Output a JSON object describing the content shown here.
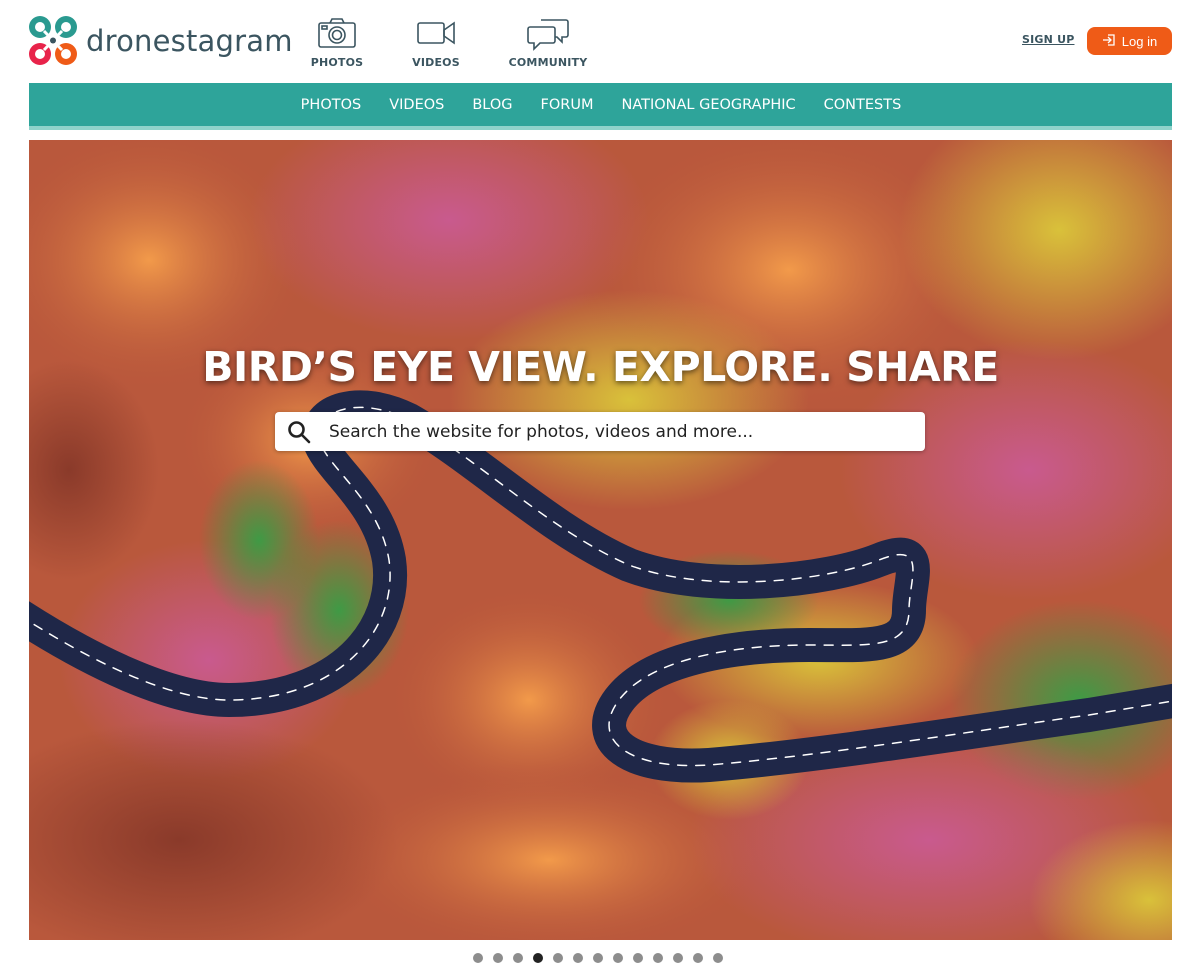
{
  "brand": {
    "name": "dronestagram"
  },
  "topnav": [
    {
      "label": "PHOTOS",
      "icon": "camera-icon"
    },
    {
      "label": "VIDEOS",
      "icon": "video-camera-icon"
    },
    {
      "label": "COMMUNITY",
      "icon": "chat-bubbles-icon"
    }
  ],
  "account": {
    "signup_label": "SIGN UP",
    "login_label": "Log in",
    "login_color": "#ef5b17"
  },
  "mainnav": {
    "color": "#2ea49a",
    "items": [
      "PHOTOS",
      "VIDEOS",
      "BLOG",
      "FORUM",
      "NATIONAL GEOGRAPHIC",
      "CONTESTS"
    ]
  },
  "hero": {
    "headline": "BIRD’S EYE VIEW. EXPLORE. SHARE",
    "search_placeholder": "Search the website for photos, videos and more...",
    "image_alt": "aerial view of winding road through autumn forest"
  },
  "carousel": {
    "total": 13,
    "active_index": 3
  }
}
